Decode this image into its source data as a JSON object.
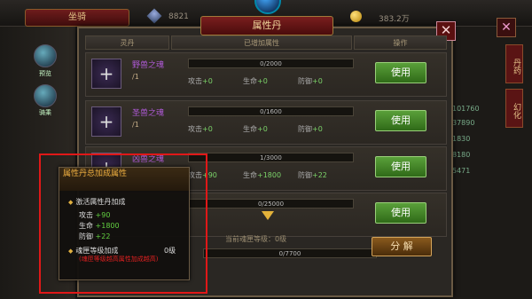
{
  "background": {
    "title": "坐骑",
    "stat_left": "8821",
    "gold": "383.2万",
    "left_items": [
      "预览",
      "骑乘"
    ],
    "right_numbers": [
      "101760",
      "37890",
      "1830",
      "8180",
      "5471"
    ],
    "right_tabs": [
      "丹药",
      "幻化"
    ],
    "close_label": "✕"
  },
  "dialog": {
    "title": "属性丹",
    "close_label": "✕",
    "columns": {
      "pill": "灵丹",
      "attrs": "已增加属性",
      "action": "操作"
    },
    "rows": [
      {
        "name": "野兽之魂",
        "count": "/1",
        "progress": "0/2000",
        "atk": "+0",
        "hp": "+0",
        "def": "+0",
        "button": "使用"
      },
      {
        "name": "圣兽之魂",
        "count": "/1",
        "progress": "0/1600",
        "atk": "+0",
        "hp": "+0",
        "def": "+0",
        "button": "使用"
      },
      {
        "name": "凶兽之魂",
        "count": "",
        "progress": "1/3000",
        "atk": "+90",
        "hp": "+1800",
        "def": "+22",
        "button": "使用"
      },
      {
        "name": "",
        "count": "",
        "progress": "0/25000",
        "atk": "",
        "hp": "",
        "def": "",
        "button": "使用"
      }
    ],
    "attr_labels": {
      "atk": "攻击",
      "hp": "生命",
      "def": "防御"
    },
    "level_label": "当前魂匣等级：0级",
    "level_progress": "0/7700",
    "decompose_button": "分 解"
  },
  "tooltip": {
    "title": "属性丹总加成属性",
    "section1": "激活属性丹加成",
    "atk_label": "攻击",
    "atk_value": "+90",
    "hp_label": "生命",
    "hp_value": "+1800",
    "def_label": "防御",
    "def_value": "+22",
    "section2": "魂匣等级加成",
    "section2_level": "0级",
    "note": "(魂匣等级越高属性加成越高)"
  }
}
